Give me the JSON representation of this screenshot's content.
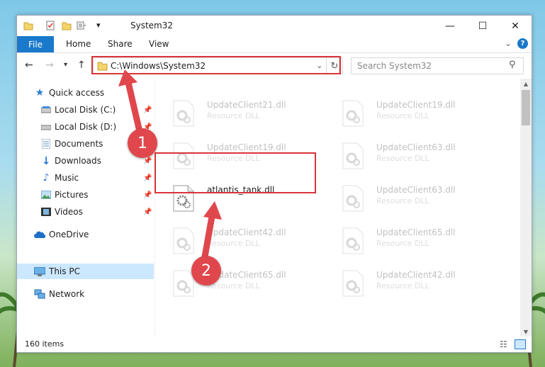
{
  "window": {
    "title": "System32",
    "controls": {
      "minimize": "—",
      "maximize": "☐",
      "close": "✕"
    }
  },
  "ribbon": {
    "tabs": [
      "File",
      "Home",
      "Share",
      "View"
    ]
  },
  "address": {
    "path": "C:\\Windows\\System32",
    "search_placeholder": "Search System32"
  },
  "nav": {
    "items": [
      {
        "label": "Quick access",
        "icon": "star-icon"
      },
      {
        "label": "Local Disk (C:)",
        "icon": "drive-icon"
      },
      {
        "label": "Local Disk (D:)",
        "icon": "drive-icon"
      },
      {
        "label": "Documents",
        "icon": "documents-icon"
      },
      {
        "label": "Downloads",
        "icon": "downloads-icon"
      },
      {
        "label": "Music",
        "icon": "music-icon"
      },
      {
        "label": "Pictures",
        "icon": "pictures-icon"
      },
      {
        "label": "Videos",
        "icon": "videos-icon"
      },
      {
        "label": "OneDrive",
        "icon": "onedrive-icon"
      },
      {
        "label": "This PC",
        "icon": "computer-icon"
      },
      {
        "label": "Network",
        "icon": "network-icon"
      }
    ]
  },
  "files": [
    {
      "name": "UpdateClient21.dll",
      "type": "Resource DLL"
    },
    {
      "name": "UpdateClient19.dll",
      "type": "Resource DLL"
    },
    {
      "name": "UpdateClient19.dll",
      "type": "Resource DLL"
    },
    {
      "name": "UpdateClient63.dll",
      "type": "Resource DLL"
    },
    {
      "name": "atlantis_tank.dll",
      "type": ""
    },
    {
      "name": "UpdateClient63.dll",
      "type": "Resource DLL"
    },
    {
      "name": "UpdateClient42.dll",
      "type": "Resource DLL"
    },
    {
      "name": "UpdateClient65.dll",
      "type": "Resource DLL"
    },
    {
      "name": "UpdateClient65.dll",
      "type": "Resource DLL"
    },
    {
      "name": "UpdateClient42.dll",
      "type": "Resource DLL"
    }
  ],
  "status": {
    "item_count": "160 items"
  },
  "annotations": {
    "marker1": "1",
    "marker2": "2"
  },
  "colors": {
    "accent": "#1979ca",
    "highlight": "#d9343a",
    "marker": "#e0474c",
    "selected": "#cce8ff"
  }
}
